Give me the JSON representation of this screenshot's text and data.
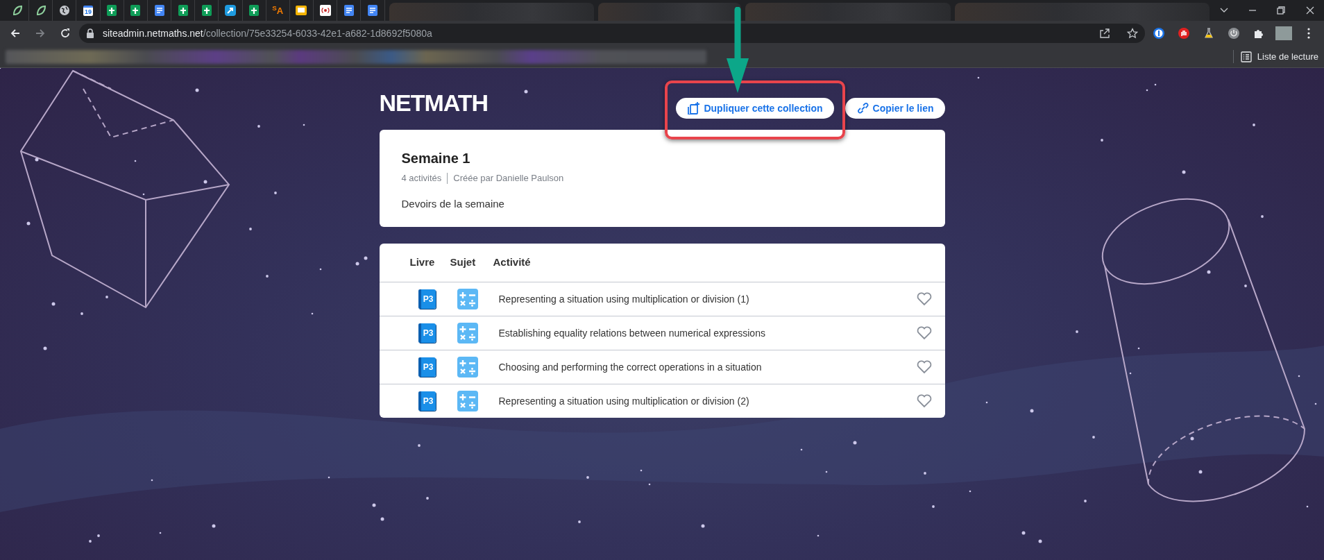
{
  "browser": {
    "tabs": [
      {
        "kind": "leaf"
      },
      {
        "kind": "leaf"
      },
      {
        "kind": "globe"
      },
      {
        "kind": "calendar",
        "label": "19"
      },
      {
        "kind": "sheet"
      },
      {
        "kind": "sheet"
      },
      {
        "kind": "doc"
      },
      {
        "kind": "sheet"
      },
      {
        "kind": "sheet"
      },
      {
        "kind": "arrow"
      },
      {
        "kind": "sheet"
      },
      {
        "kind": "letter",
        "label": "$^{S}$A"
      },
      {
        "kind": "slide"
      },
      {
        "kind": "radio"
      },
      {
        "kind": "doc"
      },
      {
        "kind": "doc"
      }
    ],
    "url_host": "siteadmin.netmaths.net",
    "url_path": "/collection/75e33254-6033-42e1-a682-1d8692f5080a",
    "reading_list": "Liste de lecture"
  },
  "logo": "NETMATH",
  "buttons": [
    {
      "kind": "duplicate",
      "label": "Dupliquer cette collection",
      "highlighted": true
    },
    {
      "kind": "link",
      "label": "Copier le lien",
      "highlighted": false
    }
  ],
  "collection": {
    "title": "Semaine 1",
    "count": "4 activités",
    "author": "Créée par Danielle Paulson",
    "description": "Devoirs de la semaine"
  },
  "table": {
    "columns": [
      "Livre",
      "Sujet",
      "Activité"
    ],
    "rows": [
      {
        "book": "P3",
        "activity": "Representing a situation using multiplication or division (1)",
        "favorite": false
      },
      {
        "book": "P3",
        "activity": "Establishing equality relations between numerical expressions",
        "favorite": false
      },
      {
        "book": "P3",
        "activity": "Choosing and performing the correct operations in a situation",
        "favorite": false
      },
      {
        "book": "P3",
        "activity": "Representing a situation using multiplication or division (2)",
        "favorite": false
      }
    ]
  }
}
